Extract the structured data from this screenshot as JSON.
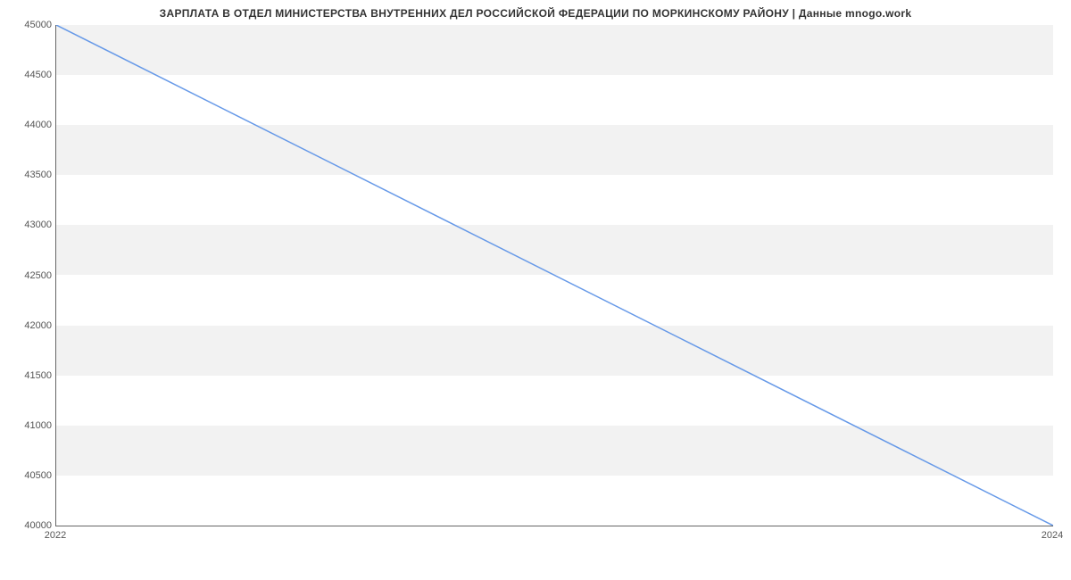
{
  "chart_data": {
    "type": "line",
    "title": "ЗАРПЛАТА В ОТДЕЛ МИНИСТЕРСТВА ВНУТРЕННИХ ДЕЛ РОССИЙСКОЙ ФЕДЕРАЦИИ ПО МОРКИНСКОМУ РАЙОНУ | Данные mnogo.work",
    "x": [
      2022,
      2024
    ],
    "values": [
      45000,
      40000
    ],
    "x_ticks": [
      2022,
      2024
    ],
    "y_ticks": [
      40000,
      40500,
      41000,
      41500,
      42000,
      42500,
      43000,
      43500,
      44000,
      44500,
      45000
    ],
    "xlim": [
      2022,
      2024
    ],
    "ylim": [
      40000,
      45000
    ],
    "xlabel": "",
    "ylabel": "",
    "line_color": "#6699e8",
    "band_color": "#f2f2f2"
  }
}
